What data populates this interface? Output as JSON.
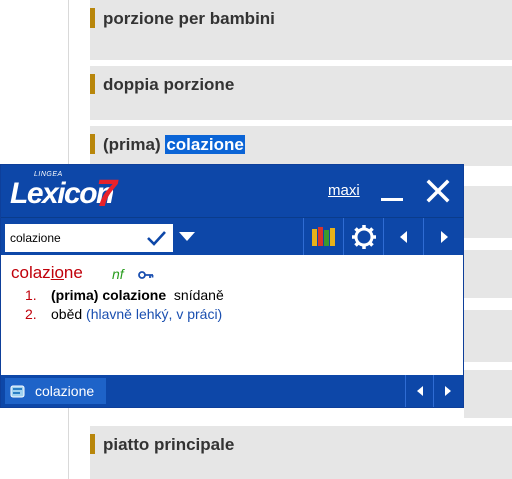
{
  "background_list": {
    "items": [
      {
        "text": "porzione per bambini"
      },
      {
        "text": "doppia porzione"
      },
      {
        "prefix": "(prima) ",
        "highlight": "colazione"
      },
      {
        "text": "piatto principale"
      }
    ],
    "accent_color": "#b8860b"
  },
  "lexicon": {
    "logo": {
      "brand": "LINGEA",
      "name": "Lexicon",
      "version": "7"
    },
    "title_bar": {
      "maxi_label": "maxi",
      "minimize_icon": "minimize-icon",
      "close_icon": "close-icon"
    },
    "search": {
      "value": "colazione",
      "confirm_icon": "checkmark-icon",
      "dropdown_icon": "chevron-down-icon"
    },
    "toolbar_icons": [
      "dictionaries-icon",
      "settings-gear-icon",
      "arrow-left-icon",
      "arrow-right-icon"
    ],
    "entry": {
      "headword_pre": "colaz",
      "headword_underlined": "io",
      "headword_post": "ne",
      "pos": "nf",
      "senses": [
        {
          "num": "1.",
          "source": "(prima) colazione",
          "target": "snídaně",
          "note": ""
        },
        {
          "num": "2.",
          "source": "",
          "target": "oběd",
          "note": "(hlavně lehký, v práci)"
        }
      ]
    },
    "status": {
      "history_item": "colazione",
      "icon": "history-book-icon"
    },
    "colors": {
      "window_blue": "#0d47a8",
      "headword_red": "#c0000a",
      "pos_green": "#2a9d1f",
      "note_blue": "#1a4fb0"
    }
  }
}
